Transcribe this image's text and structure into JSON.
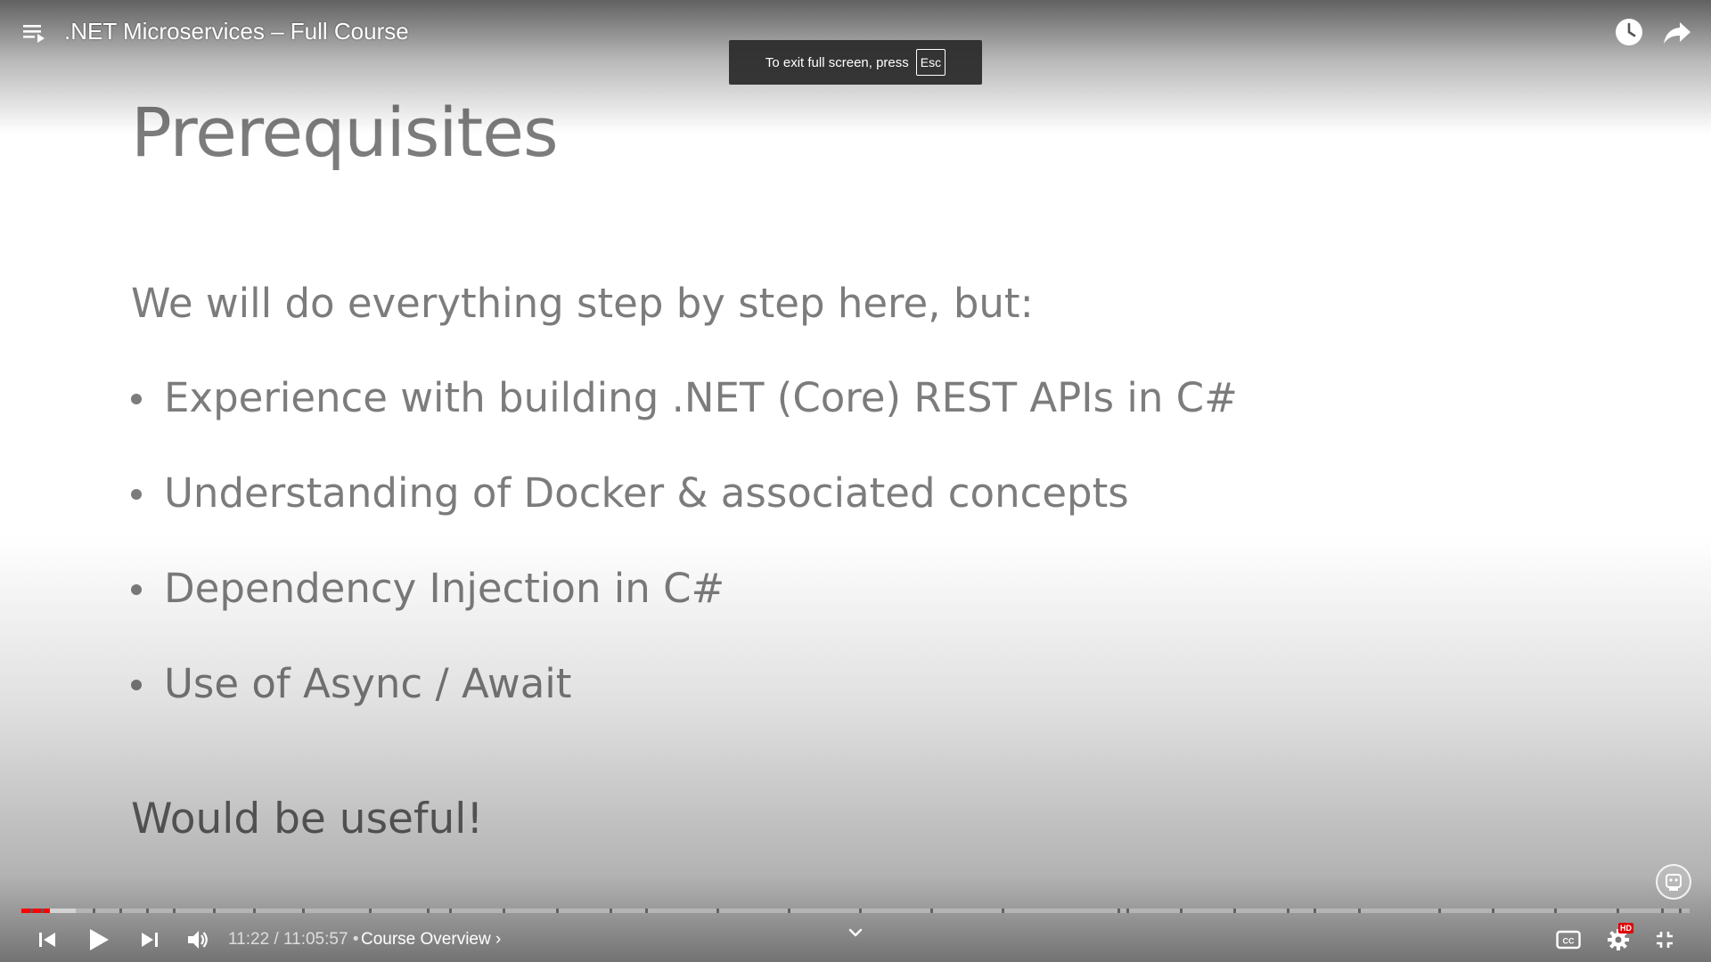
{
  "video": {
    "title": ".NET Microservices – Full Course"
  },
  "fullscreen_toast": {
    "text": "To exit full screen, press",
    "key": "Esc"
  },
  "slide": {
    "title": "Prerequisites",
    "intro": "We will do everything step by step here, but:",
    "bullets": [
      "Experience with building .NET (Core) REST APIs in C#",
      "Understanding of Docker & associated concepts",
      "Dependency Injection in C#",
      "Use of Async / Await"
    ],
    "outro": "Would be useful!"
  },
  "player": {
    "current_time": "11:22",
    "time_separator": "/",
    "duration": "11:05:57",
    "chapter_prefix": "•",
    "chapter": "Course Overview",
    "chapter_arrow": "›",
    "played_fraction": 0.0171,
    "loaded_fraction": 0.0156,
    "hd_label": "HD"
  },
  "icons": {
    "playlist": "playlist-icon",
    "watch_later": "clock-icon",
    "share": "share-icon",
    "previous": "skip-previous-icon",
    "play": "play-icon",
    "next": "skip-next-icon",
    "volume": "volume-icon",
    "expand": "chevron-down-icon",
    "captions": "cc-icon",
    "settings": "gear-icon",
    "exit_fullscreen": "exit-fullscreen-icon"
  },
  "colors": {
    "progress_played": "#ff0000",
    "slide_text": "#7c7c7c",
    "hd_badge": "#e00000"
  }
}
